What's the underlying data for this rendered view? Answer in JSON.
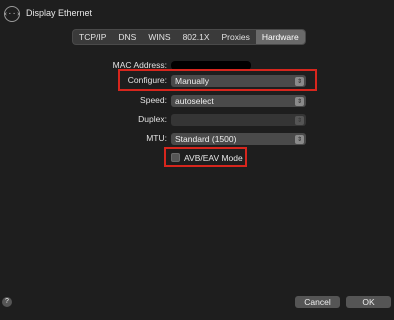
{
  "window": {
    "title": "Display Ethernet",
    "icon": "network-arrows-icon"
  },
  "tabs": [
    {
      "label": "TCP/IP",
      "active": false
    },
    {
      "label": "DNS",
      "active": false
    },
    {
      "label": "WINS",
      "active": false
    },
    {
      "label": "802.1X",
      "active": false
    },
    {
      "label": "Proxies",
      "active": false
    },
    {
      "label": "Hardware",
      "active": true
    }
  ],
  "hardware": {
    "mac_label": "MAC Address:",
    "configure_label": "Configure:",
    "configure_value": "Manually",
    "speed_label": "Speed:",
    "speed_value": "autoselect",
    "duplex_label": "Duplex:",
    "duplex_value": "",
    "mtu_label": "MTU:",
    "mtu_value": "Standard  (1500)",
    "avb_label": "AVB/EAV Mode",
    "avb_checked": false
  },
  "footer": {
    "help_label": "?",
    "cancel_label": "Cancel",
    "ok_label": "OK"
  },
  "colors": {
    "highlight": "#d7261d",
    "background": "#1e1e1e"
  }
}
